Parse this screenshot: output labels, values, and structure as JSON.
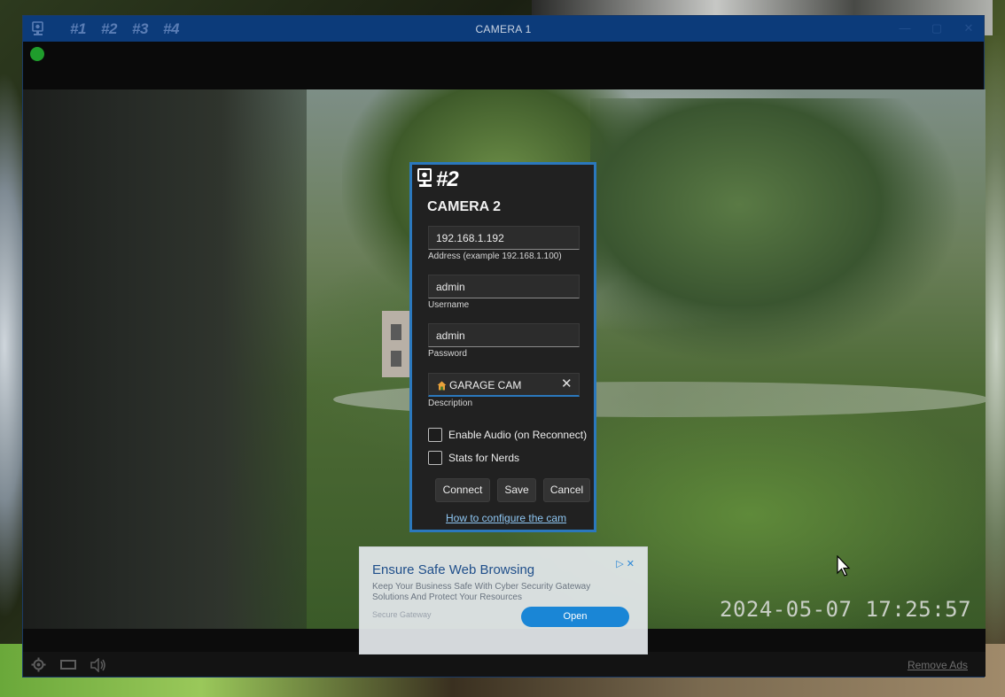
{
  "window": {
    "title": "CAMERA 1",
    "tabs": [
      "#1",
      "#2",
      "#3",
      "#4"
    ],
    "controls": {
      "minimize": "—",
      "maximize": "▢",
      "close": "✕"
    }
  },
  "video": {
    "timestamp": "2024-05-07 17:25:57"
  },
  "dialog": {
    "camera_number": "#2",
    "title": "CAMERA 2",
    "address": {
      "value": "192.168.1.192",
      "label": "Address (example 192.168.1.100)"
    },
    "username": {
      "value": "admin",
      "label": "Username"
    },
    "password": {
      "value": "admin",
      "label": "Password"
    },
    "description": {
      "value": "GARAGE CAM",
      "label": "Description",
      "clear": "✕"
    },
    "checkboxes": [
      "Enable Audio (on Reconnect)",
      "Stats for Nerds"
    ],
    "buttons": {
      "connect": "Connect",
      "save": "Save",
      "cancel": "Cancel"
    },
    "help_link": "How to configure the cam"
  },
  "ad": {
    "title": "Ensure Safe Web Browsing",
    "body": "Keep Your Business Safe With Cyber Security Gateway Solutions And Protect Your Resources",
    "source": "Secure Gateway",
    "button": "Open",
    "choices": "▷ ✕"
  },
  "bottombar": {
    "remove_ads": "Remove Ads",
    "icons": [
      "gear-icon",
      "screen-icon",
      "speaker-icon"
    ]
  },
  "colors": {
    "titlebar": "#0c3b7a",
    "dialog_border": "#2b78bd",
    "status_dot": "#1f9d2c",
    "link": "#8ec6f2"
  }
}
